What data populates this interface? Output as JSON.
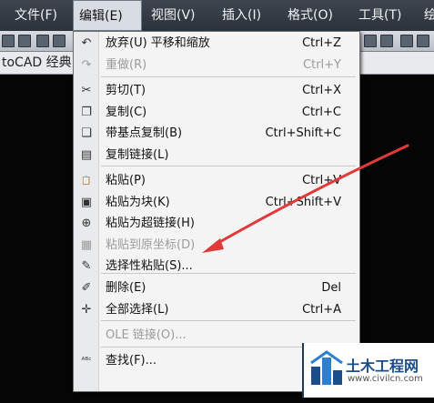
{
  "menubar": {
    "items": [
      "文件(F)",
      "编辑(E)",
      "视图(V)",
      "插入(I)",
      "格式(O)",
      "工具(T)",
      "绘"
    ]
  },
  "tabstrip": {
    "doc_tab": "toCAD 经典"
  },
  "edit_menu": {
    "items": [
      {
        "label": "放弃(U) 平移和缩放",
        "shortcut": "Ctrl+Z",
        "icon": "undo-icon",
        "glyph": "↶",
        "disabled": false
      },
      {
        "label": "重做(R)",
        "shortcut": "Ctrl+Y",
        "icon": "redo-icon",
        "glyph": "↷",
        "disabled": true
      },
      {
        "label": "剪切(T)",
        "shortcut": "Ctrl+X",
        "icon": "scissors-icon",
        "glyph": "✂",
        "disabled": false
      },
      {
        "label": "复制(C)",
        "shortcut": "Ctrl+C",
        "icon": "copy-icon",
        "glyph": "❐",
        "disabled": false
      },
      {
        "label": "带基点复制(B)",
        "shortcut": "Ctrl+Shift+C",
        "icon": "copy-basepoint-icon",
        "glyph": "❏",
        "disabled": false
      },
      {
        "label": "复制链接(L)",
        "shortcut": "",
        "icon": "copy-link-icon",
        "glyph": "▤",
        "disabled": false
      },
      {
        "label": "粘贴(P)",
        "shortcut": "Ctrl+V",
        "icon": "paste-icon",
        "glyph": "📋",
        "disabled": false
      },
      {
        "label": "粘贴为块(K)",
        "shortcut": "Ctrl+Shift+V",
        "icon": "paste-block-icon",
        "glyph": "▣",
        "disabled": false
      },
      {
        "label": "粘贴为超链接(H)",
        "shortcut": "",
        "icon": "paste-hyperlink-icon",
        "glyph": "⊕",
        "disabled": false
      },
      {
        "label": "粘贴到原坐标(D)",
        "shortcut": "",
        "icon": "paste-original-coords-icon",
        "glyph": "▦",
        "disabled": true
      },
      {
        "label": "选择性粘贴(S)...",
        "shortcut": "",
        "icon": "paste-special-icon",
        "glyph": "✎",
        "disabled": false
      },
      {
        "label": "删除(E)",
        "shortcut": "Del",
        "icon": "eraser-icon",
        "glyph": "✐",
        "disabled": false
      },
      {
        "label": "全部选择(L)",
        "shortcut": "Ctrl+A",
        "icon": "select-all-icon",
        "glyph": "✛",
        "disabled": false
      },
      {
        "label": "OLE 链接(O)...",
        "shortcut": "",
        "icon": "",
        "glyph": "",
        "disabled": true
      },
      {
        "label": "查找(F)...",
        "shortcut": "",
        "icon": "find-icon",
        "glyph": "ᴬᴮᶜ",
        "disabled": false
      }
    ]
  },
  "watermark": {
    "title": "土木工程网",
    "url": "www.civilcn.com"
  },
  "colors": {
    "arrow": "#e03a3a",
    "menu_bg": "#f4f4f4",
    "menubar_bg": "#2f3740"
  }
}
